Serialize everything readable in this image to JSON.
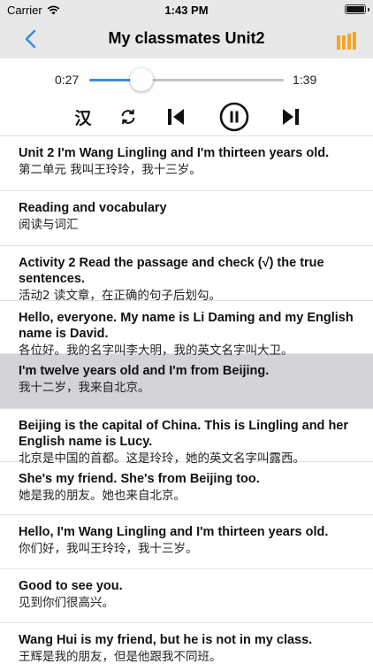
{
  "status_bar": {
    "carrier": "Carrier",
    "time": "1:43 PM"
  },
  "nav": {
    "title": "My classmates Unit2",
    "back_icon": "chevron-left-icon",
    "menu_icon": "list-bars-icon",
    "accent_color": "#3b8ce0",
    "menu_color": "#f5a623"
  },
  "player": {
    "current_time": "0:27",
    "total_time": "1:39",
    "progress": 0.27,
    "han_toggle": "汉",
    "controls": [
      "repeat-icon",
      "previous-icon",
      "pause-icon",
      "next-icon"
    ]
  },
  "sentences": [
    {
      "en": "Unit 2 I'm Wang Lingling and I'm thirteen years old.",
      "zh": "第二单元 我叫王玲玲，我十三岁。",
      "selected": false
    },
    {
      "en": "Reading and vocabulary",
      "zh": "阅读与词汇",
      "selected": false
    },
    {
      "en": "Activity 2 Read the passage and check (√) the true sentences.",
      "zh": "活动2 读文章，在正确的句子后划勾。",
      "selected": false
    },
    {
      "en": "Hello, everyone. My name is Li Daming and my English name is David.",
      "zh": "各位好。我的名字叫李大明，我的英文名字叫大卫。",
      "selected": false
    },
    {
      "en": "I'm twelve years old and I'm from Beijing.",
      "zh": "我十二岁，我来自北京。",
      "selected": true
    },
    {
      "en": "Beijing is the capital of China. This is Lingling and her English name is Lucy.",
      "zh": "北京是中国的首都。这是玲玲，她的英文名字叫露西。",
      "selected": false
    },
    {
      "en": "She's my friend. She's from Beijing too.",
      "zh": "她是我的朋友。她也来自北京。",
      "selected": false
    },
    {
      "en": "Hello, I'm Wang Lingling and I'm thirteen years old.",
      "zh": "你们好，我叫王玲玲，我十三岁。",
      "selected": false
    },
    {
      "en": "Good to see you.",
      "zh": "见到你们很高兴。",
      "selected": false
    },
    {
      "en": "Wang Hui is my friend, but he is not in my class.",
      "zh": "王辉是我的朋友，但是他跟我不同班。",
      "selected": false
    }
  ]
}
